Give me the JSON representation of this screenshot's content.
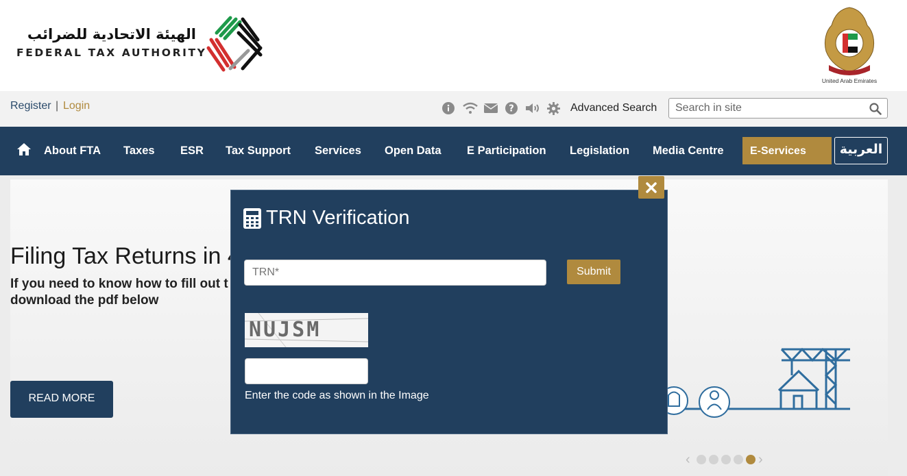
{
  "header": {
    "org_name_ar": "الهيئة الاتحادية للضرائب",
    "org_name_en": "FEDERAL TAX AUTHORITY",
    "emblem_caption": "United Arab Emirates",
    "emblem_ribbon_ar": "الإمارات العربية المتحدة"
  },
  "utility": {
    "register": "Register",
    "separator": "|",
    "login": "Login",
    "icons": [
      "info-icon",
      "wifi-icon",
      "envelope-icon",
      "question-icon",
      "volume-icon",
      "gear-icon"
    ],
    "advanced_search": "Advanced Search",
    "search_placeholder": "Search in site"
  },
  "nav": {
    "items": [
      "About FTA",
      "Taxes",
      "ESR",
      "Tax Support",
      "Services",
      "Open Data",
      "E Participation",
      "Legislation",
      "Media Centre"
    ],
    "eservices": "E-Services",
    "arabic": "العربية"
  },
  "hero": {
    "title": "Filing Tax Returns in 4",
    "subtitle": "If you need to know how to fill out t download the pdf below",
    "read_more": "READ MORE",
    "carousel_dots": 5,
    "active_dot": 5
  },
  "modal": {
    "title": "TRN Verification",
    "trn_placeholder": "TRN*",
    "submit": "Submit",
    "captcha_text": "NUJSM",
    "code_hint": "Enter the code as shown in the Image"
  },
  "colors": {
    "navy": "#213f5e",
    "gold": "#b08a3e"
  }
}
